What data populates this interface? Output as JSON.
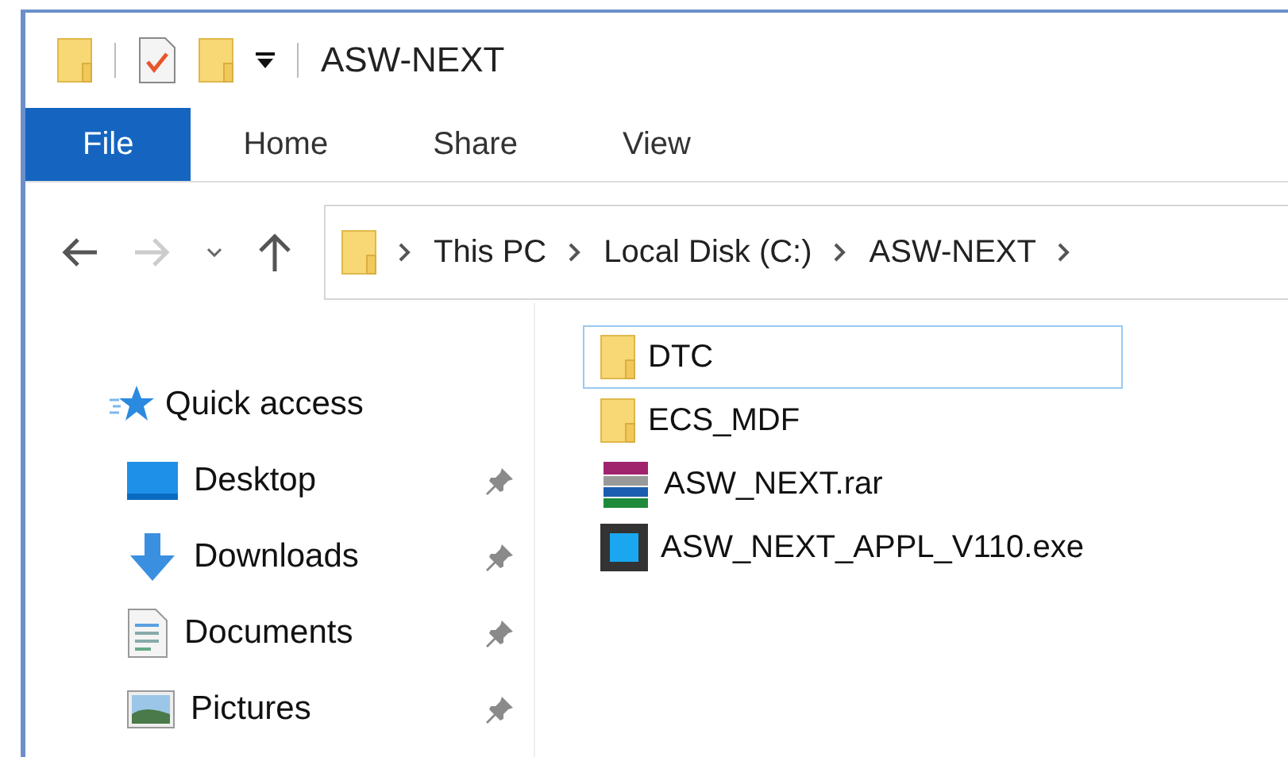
{
  "window": {
    "title": "ASW-NEXT"
  },
  "tabs": [
    {
      "label": "File",
      "selected": true
    },
    {
      "label": "Home",
      "selected": false
    },
    {
      "label": "Share",
      "selected": false
    },
    {
      "label": "View",
      "selected": false
    }
  ],
  "navigation": {
    "back_disabled": false,
    "forward_disabled": true
  },
  "breadcrumb": [
    "This PC",
    "Local Disk (C:)",
    "ASW-NEXT"
  ],
  "sidebar": {
    "header": "Quick access",
    "items": [
      {
        "label": "Desktop",
        "kind": "desktop",
        "pinned": true
      },
      {
        "label": "Downloads",
        "kind": "downloads",
        "pinned": true
      },
      {
        "label": "Documents",
        "kind": "documents",
        "pinned": true
      },
      {
        "label": "Pictures",
        "kind": "pictures",
        "pinned": true
      }
    ]
  },
  "files": [
    {
      "name": "DTC",
      "kind": "folder",
      "selected": true
    },
    {
      "name": "ECS_MDF",
      "kind": "folder",
      "selected": false
    },
    {
      "name": "ASW_NEXT.rar",
      "kind": "archive",
      "selected": false
    },
    {
      "name": "ASW_NEXT_APPL_V110.exe",
      "kind": "executable",
      "selected": false
    }
  ]
}
